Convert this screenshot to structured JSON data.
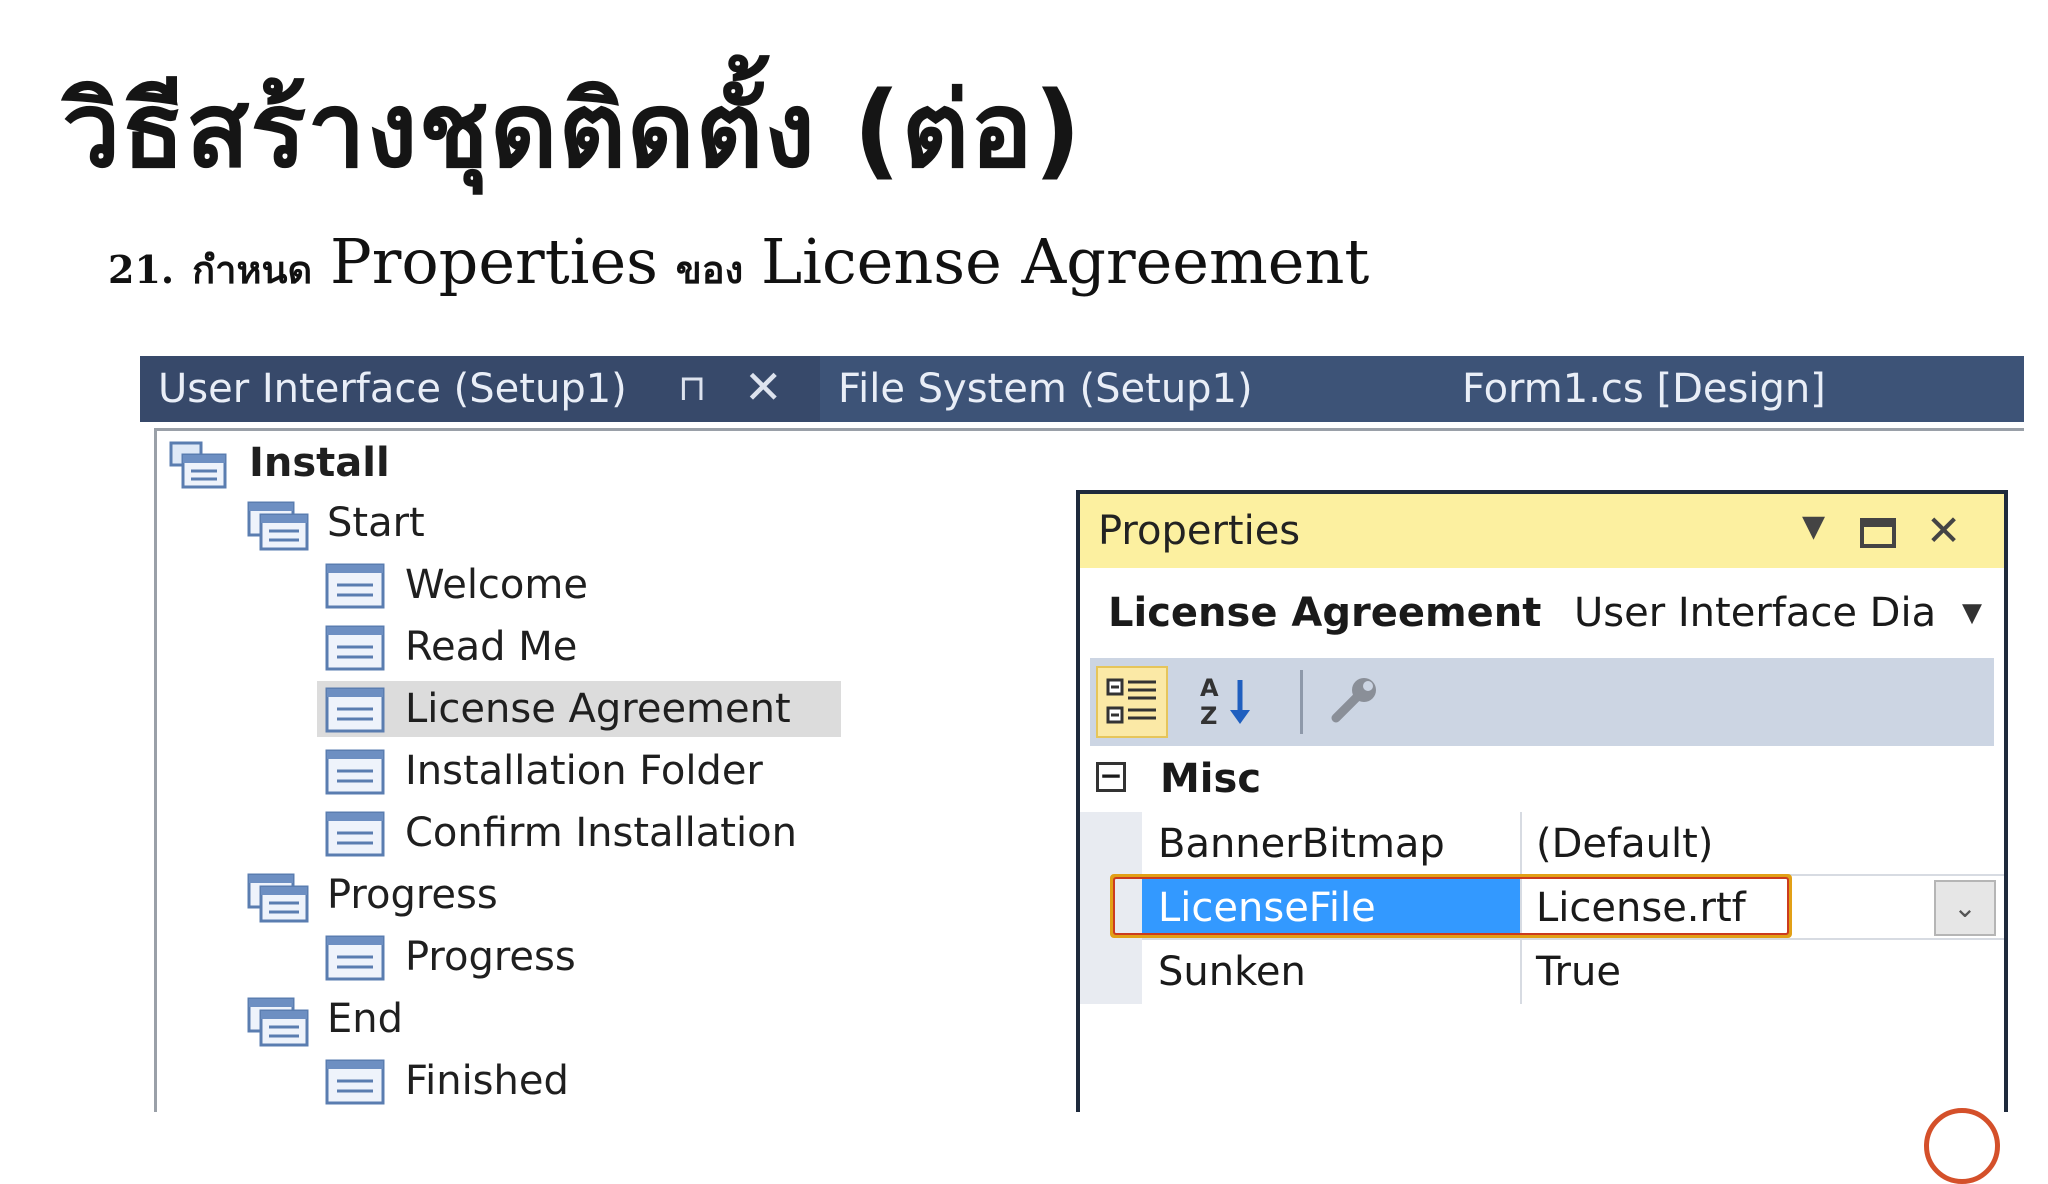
{
  "slide": {
    "title": "วิธีสร้างชุดติดตั้ง (ต่อ)",
    "step_number": "21.",
    "step_text_1": "กำหนด",
    "step_text_2": "Properties",
    "step_text_3": "ของ",
    "step_text_4": "License Agreement"
  },
  "tabs": {
    "ui": "User Interface (Setup1)",
    "pin": "⊓",
    "close": "✕",
    "fs": "File System (Setup1)",
    "form": "Form1.cs [Design]"
  },
  "tree": {
    "install": "Install",
    "start": "Start",
    "welcome": "Welcome",
    "readme": "Read Me",
    "license": "License Agreement",
    "installfolder": "Installation Folder",
    "confirm": "Confirm Installation",
    "progress_group": "Progress",
    "progress_item": "Progress",
    "end": "End",
    "finished": "Finished"
  },
  "properties": {
    "title": "Properties",
    "object_name": "License Agreement",
    "object_type": "User Interface Dia",
    "category": "Misc",
    "category_toggle": "−",
    "rows": [
      {
        "name": "BannerBitmap",
        "value": "(Default)"
      },
      {
        "name": "LicenseFile",
        "value": "License.rtf"
      },
      {
        "name": "Sunken",
        "value": "True"
      }
    ],
    "dropdown_glyph": "⌄"
  },
  "icons": {
    "tree_root": "setup-tree-icon",
    "group": "dialog-group-icon",
    "dialog": "dialog-icon",
    "categorized": "categorized-icon",
    "alphabetical": "sort-az-icon",
    "property_pages": "wrench-icon"
  },
  "colors": {
    "tab_bar": "#3d5377",
    "properties_title": "#fcf0a0",
    "selection": "#3399ff",
    "highlight": "#e2a016"
  }
}
